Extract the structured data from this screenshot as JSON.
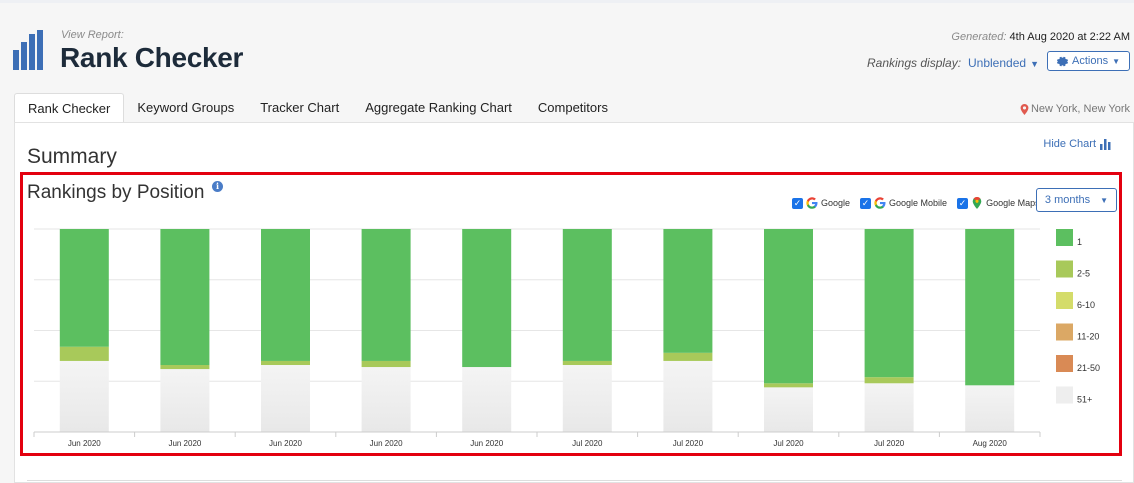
{
  "header": {
    "view_report_label": "View Report:",
    "title": "Rank Checker",
    "generated_label": "Generated:",
    "generated_value": "4th Aug 2020 at 2:22 AM",
    "rankings_display_label": "Rankings display:",
    "rankings_display_value": "Unblended",
    "actions_label": "Actions"
  },
  "tabs": [
    {
      "label": "Rank Checker",
      "active": true
    },
    {
      "label": "Keyword Groups",
      "active": false
    },
    {
      "label": "Tracker Chart",
      "active": false
    },
    {
      "label": "Aggregate Ranking Chart",
      "active": false
    },
    {
      "label": "Competitors",
      "active": false
    }
  ],
  "location": "New York, New York",
  "summary": {
    "heading": "Summary",
    "hide_chart_label": "Hide Chart"
  },
  "chart_section": {
    "title": "Rankings by Position",
    "engines": [
      {
        "label": "Google",
        "checked": true
      },
      {
        "label": "Google Mobile",
        "checked": true
      },
      {
        "label": "Google Maps",
        "checked": true
      }
    ],
    "range_label": "3 months"
  },
  "colors": {
    "accent": "#3d6fb6",
    "highlight": "#e3000f",
    "pos_1": "#5cbf60",
    "pos_2_5": "#a8c95a",
    "pos_6_10": "#d4dc6a",
    "pos_11_20": "#dba865",
    "pos_21_50": "#d98a55",
    "pos_51": "#eeeeee"
  },
  "chart_data": {
    "type": "bar",
    "stacked": true,
    "percent_stacked": true,
    "categories": [
      "Jun 2020",
      "Jun 2020",
      "Jun 2020",
      "Jun 2020",
      "Jun 2020",
      "Jul 2020",
      "Jul 2020",
      "Jul 2020",
      "Jul 2020",
      "Aug 2020"
    ],
    "series": [
      {
        "name": "1",
        "color": "#5cbf60",
        "values": [
          58,
          67,
          65,
          65,
          68,
          65,
          61,
          76,
          73,
          77
        ]
      },
      {
        "name": "2-5",
        "color": "#a8c95a",
        "values": [
          7,
          2,
          2,
          3,
          0,
          2,
          4,
          2,
          3,
          0
        ]
      },
      {
        "name": "6-10",
        "color": "#d4dc6a",
        "values": [
          0,
          0,
          0,
          0,
          0,
          0,
          0,
          0,
          0,
          0
        ]
      },
      {
        "name": "11-20",
        "color": "#dba865",
        "values": [
          0,
          0,
          0,
          0,
          0,
          0,
          0,
          0,
          0,
          0
        ]
      },
      {
        "name": "21-50",
        "color": "#d98a55",
        "values": [
          0,
          0,
          0,
          0,
          0,
          0,
          0,
          0,
          0,
          0
        ]
      },
      {
        "name": "51+",
        "color": "#eeeeee",
        "values": [
          35,
          31,
          33,
          32,
          32,
          33,
          35,
          22,
          24,
          23
        ]
      }
    ],
    "ylim": [
      0,
      100
    ],
    "grid": true,
    "legend": "right"
  }
}
